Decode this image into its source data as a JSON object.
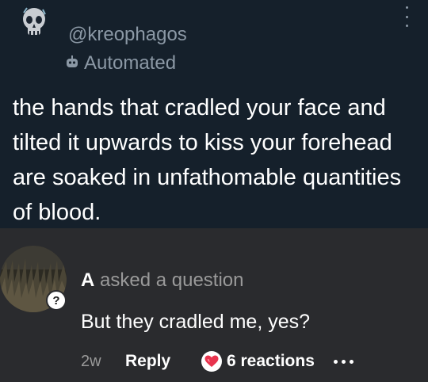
{
  "tweet": {
    "handle": "@kreophagos",
    "badge_label": "Automated",
    "text": "the hands that cradled your face and tilted it upwards to kiss your forehead are soaked in unfathomable quantities of blood.",
    "background": "#15202b",
    "avatar_icon": "skull-avatar",
    "menu_icon": "vertical-dots-icon",
    "badge_icon": "robot-icon"
  },
  "reply": {
    "asker_name": "A",
    "asker_action": "asked a question",
    "text": "But they cradled me, yes?",
    "time": "2w",
    "reply_label": "Reply",
    "reactions_label": "6 reactions",
    "reaction_icon": "heart-icon",
    "more_icon": "more-horizontal-icon",
    "question_badge": "?",
    "background": "#2a2b2e",
    "accent_heart": "#e8344e"
  }
}
